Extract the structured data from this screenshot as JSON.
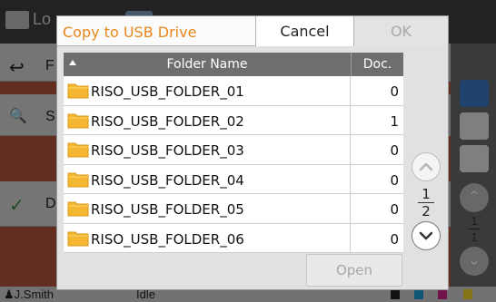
{
  "background": {
    "title_fragment": "Lo",
    "rows": [
      {
        "glyph": "↩",
        "label": "F"
      },
      {
        "glyph": "🔍",
        "label": "S"
      },
      {
        "glyph": "✓",
        "label": "D"
      }
    ],
    "right_page": {
      "current": "1",
      "total": "1"
    },
    "status_user": "J.Smith",
    "status_state": "Idle",
    "ink_letters": [
      "K",
      "C",
      "M",
      "Y"
    ]
  },
  "dialog": {
    "title": "Copy to USB Drive",
    "cancel_label": "Cancel",
    "ok_label": "OK",
    "open_label": "Open",
    "columns": {
      "name": "Folder Name",
      "doc": "Doc."
    },
    "folders": [
      {
        "name": "RISO_USB_FOLDER_01",
        "doc": "0"
      },
      {
        "name": "RISO_USB_FOLDER_02",
        "doc": "1"
      },
      {
        "name": "RISO_USB_FOLDER_03",
        "doc": "0"
      },
      {
        "name": "RISO_USB_FOLDER_04",
        "doc": "0"
      },
      {
        "name": "RISO_USB_FOLDER_05",
        "doc": "0"
      },
      {
        "name": "RISO_USB_FOLDER_06",
        "doc": "0"
      }
    ],
    "page": {
      "current": "1",
      "total": "2"
    },
    "colors": {
      "title": "#e8871c",
      "folder": "#f5b731",
      "header": "#6e6e6e"
    }
  }
}
